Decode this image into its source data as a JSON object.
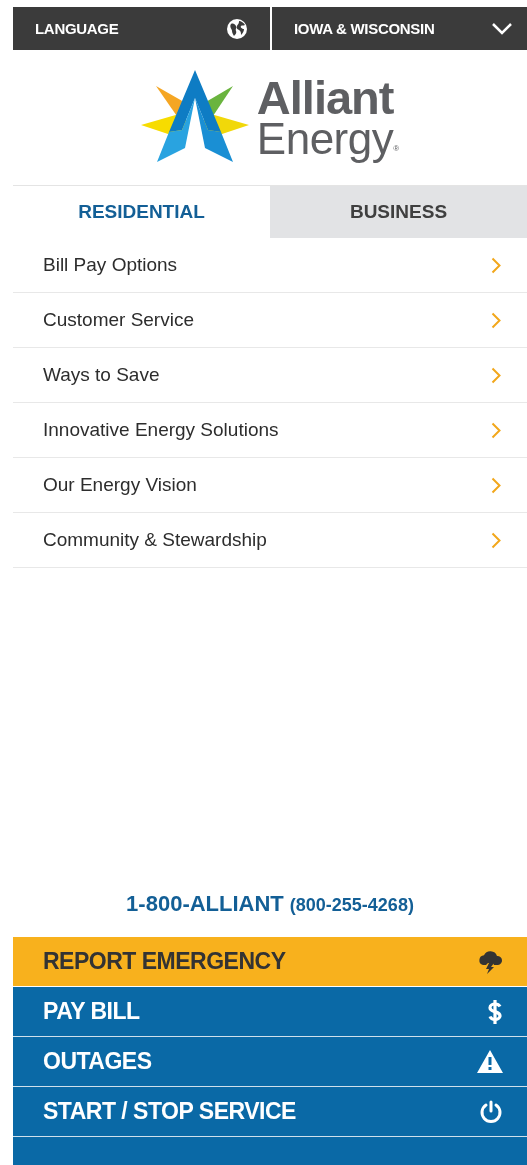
{
  "top_bar": {
    "language": "LANGUAGE",
    "region": "IOWA & WISCONSIN"
  },
  "logo": {
    "line_1": "Alliant",
    "line_2": "Energy",
    "mark": "®"
  },
  "tabs": [
    {
      "label": "RESIDENTIAL",
      "selected": true
    },
    {
      "label": "BUSINESS",
      "selected": false
    }
  ],
  "menu": [
    "Bill Pay Options",
    "Customer Service",
    "Ways to Save",
    "Innovative Energy Solutions",
    "Our Energy Vision",
    "Community & Stewardship"
  ],
  "phone": {
    "name": "1-800-ALLIANT",
    "number": "(800-255-4268)"
  },
  "actions": [
    {
      "label": "REPORT EMERGENCY",
      "kind": "storm",
      "emphasized": true
    },
    {
      "label": "PAY BILL",
      "kind": "dollar",
      "emphasized": false
    },
    {
      "label": "OUTAGES",
      "kind": "warning",
      "emphasized": false
    },
    {
      "label": "START / STOP SERVICE",
      "kind": "power",
      "emphasized": false
    }
  ]
}
